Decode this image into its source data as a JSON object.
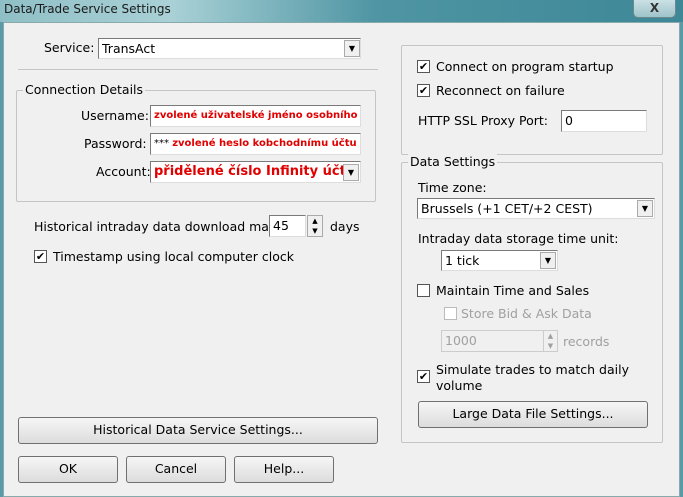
{
  "window": {
    "title": "Data/Trade Service Settings",
    "close": "X"
  },
  "service": {
    "label": "Service:",
    "value": "TransAct"
  },
  "connection": {
    "title": "Connection Details",
    "username_label": "Username:",
    "username_value": "zvolené uživatelské jméno osobního účtu",
    "password_label": "Password:",
    "password_mask": "***",
    "password_value": "zvolené heslo kobchodnímu účtu",
    "account_label": "Account:",
    "account_value": "přidělené číslo Infinity účtu"
  },
  "historical": {
    "label": "Historical intraday data download max:",
    "value": "45",
    "unit": "days"
  },
  "timestamp": {
    "label": "Timestamp using local computer clock",
    "checked": true
  },
  "hist_button": "Historical Data Service Settings...",
  "buttons": {
    "ok": "OK",
    "cancel": "Cancel",
    "help": "Help..."
  },
  "startup": {
    "connect_label": "Connect on program startup",
    "connect_checked": true,
    "reconnect_label": "Reconnect on failure",
    "reconnect_checked": true,
    "proxy_label": "HTTP SSL Proxy Port:",
    "proxy_value": "0"
  },
  "data_settings": {
    "title": "Data Settings",
    "tz_label": "Time zone:",
    "tz_value": "Brussels (+1 CET/+2 CEST)",
    "unit_label": "Intraday data storage time unit:",
    "unit_value": "1 tick",
    "maintain_label": "Maintain Time and Sales",
    "maintain_checked": false,
    "store_label": "Store Bid & Ask Data",
    "store_checked": false,
    "records_value": "1000",
    "records_unit": "records",
    "simulate_label": "Simulate trades to match daily volume",
    "simulate_checked": true,
    "large_button": "Large Data File Settings..."
  }
}
